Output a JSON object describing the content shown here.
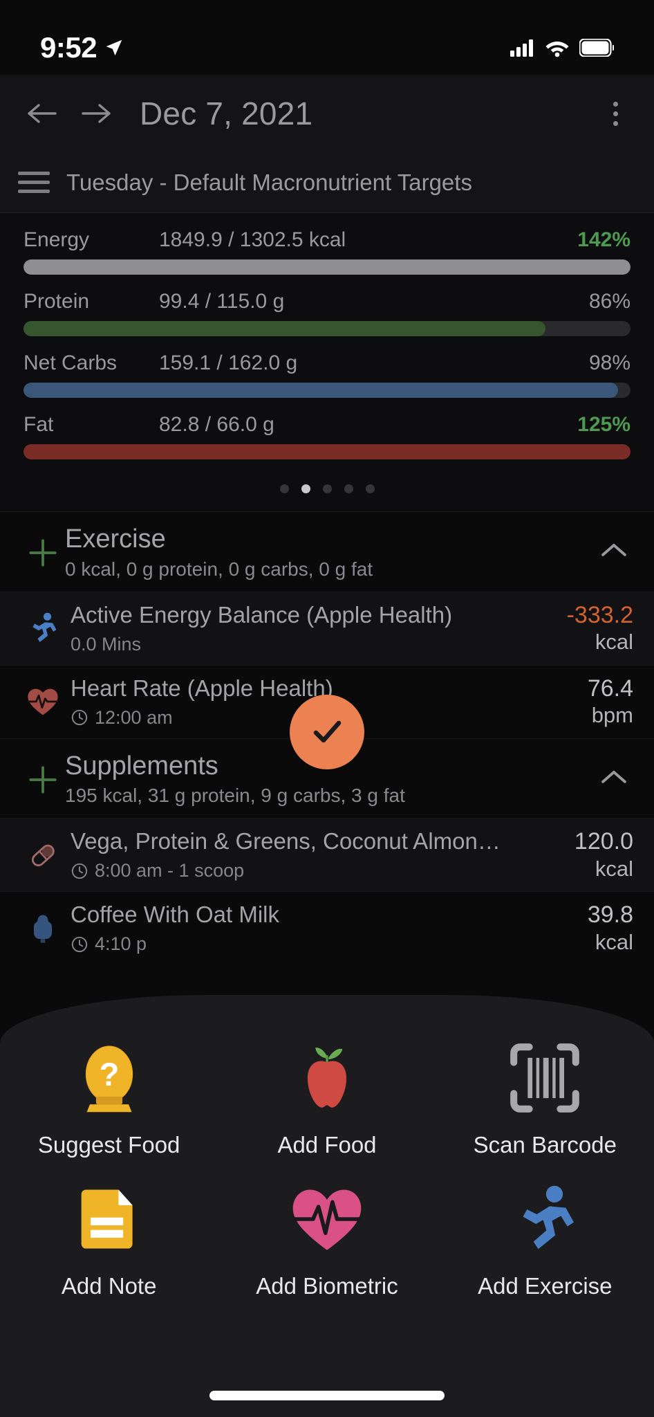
{
  "status_bar": {
    "time": "9:52",
    "location_icon": "location-arrow-icon",
    "signal_icon": "cellular-signal-icon",
    "wifi_icon": "wifi-icon",
    "battery_icon": "battery-full-icon"
  },
  "nav": {
    "back_icon": "arrow-left-icon",
    "forward_icon": "arrow-right-icon",
    "title": "Dec 7, 2021",
    "menu_icon": "overflow-menu-icon"
  },
  "day_header": {
    "menu_icon": "hamburger-icon",
    "label": "Tuesday - Default Macronutrient Targets"
  },
  "macros": {
    "rows": [
      {
        "name": "Energy",
        "values": "1849.9 / 1302.5 kcal",
        "percent": "142%",
        "fill": 100,
        "color": "#8e8e93",
        "over": true
      },
      {
        "name": "Protein",
        "values": "99.4 / 115.0 g",
        "percent": "86%",
        "fill": 86,
        "color": "#35562f",
        "over": false
      },
      {
        "name": "Net Carbs",
        "values": "159.1 / 162.0 g",
        "percent": "98%",
        "fill": 98,
        "color": "#3a5679",
        "over": false
      },
      {
        "name": "Fat",
        "values": "82.8 / 66.0 g",
        "percent": "125%",
        "fill": 100,
        "color": "#7a2b26",
        "over": true
      }
    ],
    "pagination": {
      "count": 5,
      "active_index": 1
    }
  },
  "sections": [
    {
      "title": "Exercise",
      "subtitle": "0 kcal, 0 g protein, 0 g carbs, 0 g fat",
      "add_icon": "plus-icon",
      "collapse_icon": "chevron-up-icon",
      "entries": [
        {
          "icon": "running-person-icon",
          "title": "Active Energy Balance (Apple Health)",
          "sub": "0.0 Mins",
          "sub_icon": "",
          "value": "-333.2",
          "unit": "kcal",
          "negative": true
        },
        {
          "icon": "heart-pulse-icon",
          "title": "Heart Rate (Apple Health)",
          "sub": "12:00 am",
          "sub_icon": "clock-icon",
          "value": "76.4",
          "unit": "bpm",
          "negative": false
        }
      ]
    },
    {
      "title": "Supplements",
      "subtitle": "195 kcal, 31 g protein, 9 g carbs, 3 g fat",
      "add_icon": "plus-icon",
      "collapse_icon": "chevron-up-icon",
      "entries": [
        {
          "icon": "pill-capsule-icon",
          "title": "Vega, Protein & Greens, Coconut Almon…",
          "sub": "8:00 am - 1 scoop",
          "sub_icon": "clock-icon",
          "value": "120.0",
          "unit": "kcal",
          "negative": false
        },
        {
          "icon": "drink-cup-icon",
          "title": "Coffee With Oat Milk",
          "sub": "4:10 p",
          "sub_icon": "clock-icon",
          "value": "39.8",
          "unit": "kcal",
          "negative": false
        }
      ]
    }
  ],
  "fab": {
    "icon": "checkmark-icon",
    "color": "#ec8152"
  },
  "sheet": {
    "actions": [
      {
        "label": "Suggest Food",
        "icon": "crystal-ball-question-icon"
      },
      {
        "label": "Add Food",
        "icon": "apple-icon"
      },
      {
        "label": "Scan Barcode",
        "icon": "barcode-scan-icon"
      },
      {
        "label": "Add Note",
        "icon": "note-document-icon"
      },
      {
        "label": "Add Biometric",
        "icon": "heart-ecg-icon"
      },
      {
        "label": "Add Exercise",
        "icon": "running-person-icon"
      }
    ]
  },
  "home_indicator": "home-indicator"
}
